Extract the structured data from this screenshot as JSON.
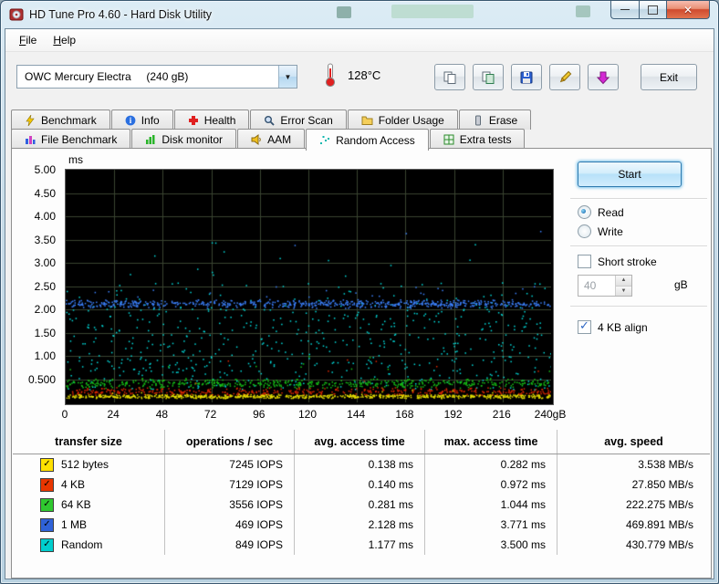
{
  "window": {
    "title": "HD Tune Pro 4.60 - Hard Disk Utility",
    "min_label": "—",
    "close_label": "✕"
  },
  "menu": {
    "file": {
      "accel": "F",
      "rest": "ile"
    },
    "help": {
      "accel": "H",
      "rest": "elp"
    }
  },
  "toolbar": {
    "drive_select": "OWC Mercury Electra     (240 gB)",
    "temperature": "128°C",
    "exit_label": "Exit"
  },
  "tabs": {
    "row1": [
      {
        "label": "Benchmark"
      },
      {
        "label": "Info"
      },
      {
        "label": "Health"
      },
      {
        "label": "Error Scan"
      },
      {
        "label": "Folder Usage"
      },
      {
        "label": "Erase"
      }
    ],
    "row2": [
      {
        "label": "File Benchmark"
      },
      {
        "label": "Disk monitor"
      },
      {
        "label": "AAM"
      },
      {
        "label": "Random Access"
      },
      {
        "label": "Extra tests"
      }
    ]
  },
  "controls": {
    "start_label": "Start",
    "read_label": "Read",
    "write_label": "Write",
    "short_stroke_label": "Short stroke",
    "short_stroke_value": "40",
    "unit_label": "gB",
    "align_label": "4 KB align"
  },
  "table": {
    "headers": [
      "transfer size",
      "operations / sec",
      "avg. access time",
      "max. access time",
      "avg. speed"
    ],
    "check_glyph": "✓",
    "rows": [
      {
        "label": "512 bytes",
        "check_color": "#ffe000",
        "iops": "7245 IOPS",
        "avg": "0.138 ms",
        "max": "0.282 ms",
        "speed": "3.538 MB/s"
      },
      {
        "label": "4 KB",
        "check_color": "#e83600",
        "iops": "7129 IOPS",
        "avg": "0.140 ms",
        "max": "0.972 ms",
        "speed": "27.850 MB/s"
      },
      {
        "label": "64 KB",
        "check_color": "#2fc82f",
        "iops": "3556 IOPS",
        "avg": "0.281 ms",
        "max": "1.044 ms",
        "speed": "222.275 MB/s"
      },
      {
        "label": "1 MB",
        "check_color": "#2f62d8",
        "iops": "469 IOPS",
        "avg": "2.128 ms",
        "max": "3.771 ms",
        "speed": "469.891 MB/s"
      },
      {
        "label": "Random",
        "check_color": "#00cdcd",
        "iops": "849 IOPS",
        "avg": "1.177 ms",
        "max": "3.500 ms",
        "speed": "430.779 MB/s"
      }
    ]
  },
  "chart_data": {
    "type": "scatter",
    "title": "Random Access benchmark - access time vs disk position",
    "xlabel": "gB",
    "ylabel": "ms",
    "xlim": [
      0,
      240
    ],
    "ylim": [
      0,
      5
    ],
    "x_ticks": [
      "0",
      "24",
      "48",
      "72",
      "96",
      "120",
      "144",
      "168",
      "192",
      "216",
      "240gB"
    ],
    "y_ticks": [
      "5.00",
      "4.50",
      "4.00",
      "3.50",
      "3.00",
      "2.50",
      "2.00",
      "1.50",
      "1.00",
      "0.500"
    ],
    "grid": {
      "x_step": 24,
      "y_step": 0.5,
      "color": "#3a4430",
      "on": true
    },
    "legend_position": "table-below",
    "series": [
      {
        "name": "Random",
        "color": "#00dcdc",
        "avg_ms": 1.177,
        "max_ms": 3.5,
        "dist": "uniform",
        "count": 520,
        "min": 0.28,
        "max": 2.05,
        "outliers": [
          {
            "count": 70,
            "min": 2.0,
            "max": 2.6
          },
          {
            "count": 14,
            "min": 2.6,
            "max": 3.5
          }
        ]
      },
      {
        "name": "1 MB",
        "color": "#3c82ff",
        "avg_ms": 2.128,
        "max_ms": 3.771,
        "dist": "gauss",
        "count": 650,
        "center": 2.13,
        "spread": 0.05,
        "min": 2.03,
        "max": 2.32,
        "outliers": [
          {
            "count": 20,
            "min": 2.25,
            "max": 2.5
          },
          {
            "count": 3,
            "min": 3.35,
            "max": 3.77
          }
        ]
      },
      {
        "name": "64 KB",
        "color": "#17c517",
        "avg_ms": 0.281,
        "max_ms": 1.044,
        "dist": "gauss",
        "count": 520,
        "center": 0.42,
        "spread": 0.055,
        "min": 0.3,
        "max": 0.55,
        "outliers": [
          {
            "count": 10,
            "min": 0.55,
            "max": 1.04
          }
        ]
      },
      {
        "name": "4 KB",
        "color": "#e02800",
        "avg_ms": 0.14,
        "max_ms": 0.972,
        "dist": "gauss",
        "count": 430,
        "center": 0.24,
        "spread": 0.05,
        "min": 0.17,
        "max": 0.33,
        "outliers": [
          {
            "count": 8,
            "min": 0.4,
            "max": 0.97
          }
        ]
      },
      {
        "name": "512 bytes",
        "color": "#e8e000",
        "avg_ms": 0.138,
        "max_ms": 0.282,
        "dist": "gauss",
        "count": 760,
        "center": 0.14,
        "spread": 0.025,
        "min": 0.1,
        "max": 0.2,
        "outliers": [
          {
            "count": 6,
            "min": 0.2,
            "max": 0.28
          }
        ]
      }
    ]
  }
}
